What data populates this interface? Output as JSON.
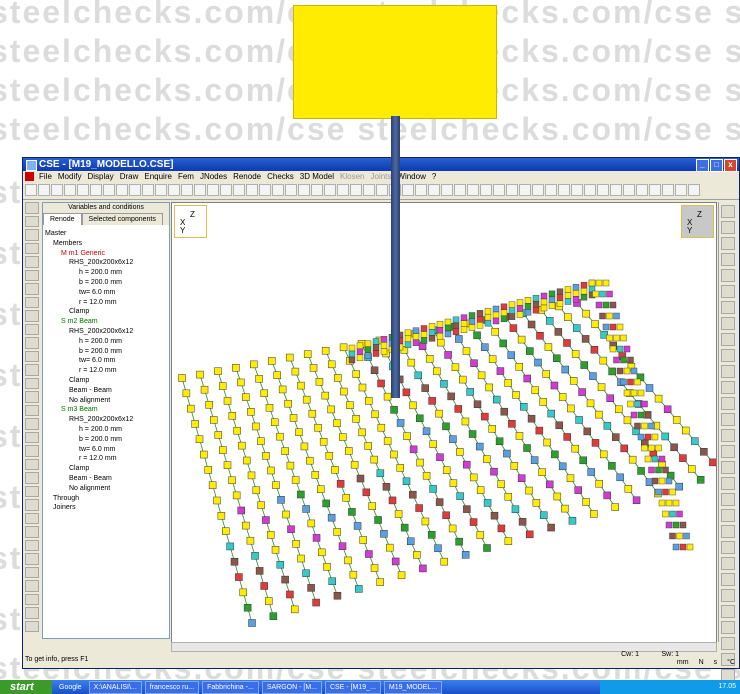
{
  "watermark": {
    "text": "steelchecks.com/cse steelchecks.com/cse steelchecks.com/cse"
  },
  "window": {
    "title": "CSE - [M19_MODELLO.CSE]"
  },
  "menu": [
    "File",
    "Modify",
    "Display",
    "Draw",
    "Enquire",
    "Fem",
    "JNodes",
    "Renode",
    "Checks",
    "3D Model",
    "Klosen",
    "Joints",
    "Window",
    "?"
  ],
  "panel": {
    "header": "Variables and conditions",
    "tabs": [
      "Renode",
      "Selected components"
    ],
    "tree": [
      "Master",
      "Members",
      "M  m1 Generic",
      "RHS_200x200x6x12",
      "h = 200.0 mm",
      "b = 200.0 mm",
      "tw= 6.0 mm",
      "r = 12.0 mm",
      "Clamp",
      "S  m2 Beam",
      "RHS_200x200x6x12",
      "h = 200.0 mm",
      "b = 200.0 mm",
      "tw= 6.0 mm",
      "r = 12.0 mm",
      "Clamp",
      "Beam - Beam",
      "No alignment",
      "S  m3 Beam",
      "RHS_200x200x6x12",
      "h = 200.0 mm",
      "b = 200.0 mm",
      "tw= 6.0 mm",
      "r = 12.0 mm",
      "Clamp",
      "Beam - Beam",
      "No alignment",
      "Through",
      "Joiners"
    ]
  },
  "axis": {
    "z": "Z",
    "x": "X",
    "y": "Y"
  },
  "status": {
    "left": "To get info, press F1",
    "cw": "Cw: 1",
    "sw": "Sw: 1",
    "units": [
      "mm",
      "N",
      "s",
      "°C"
    ]
  },
  "taskbar": {
    "start": "start",
    "items": [
      "Google",
      "X:\\ANALISI\\...",
      "francesco ru...",
      "Fabbrichina -...",
      "SARGON - [M...",
      "CSE - [M19_...",
      "M19_MODEL..."
    ],
    "clock": "17.05"
  },
  "colors": {
    "callout": "#ffec00",
    "pointer": "#3b5998",
    "titlebar": "#0a3ab0"
  }
}
